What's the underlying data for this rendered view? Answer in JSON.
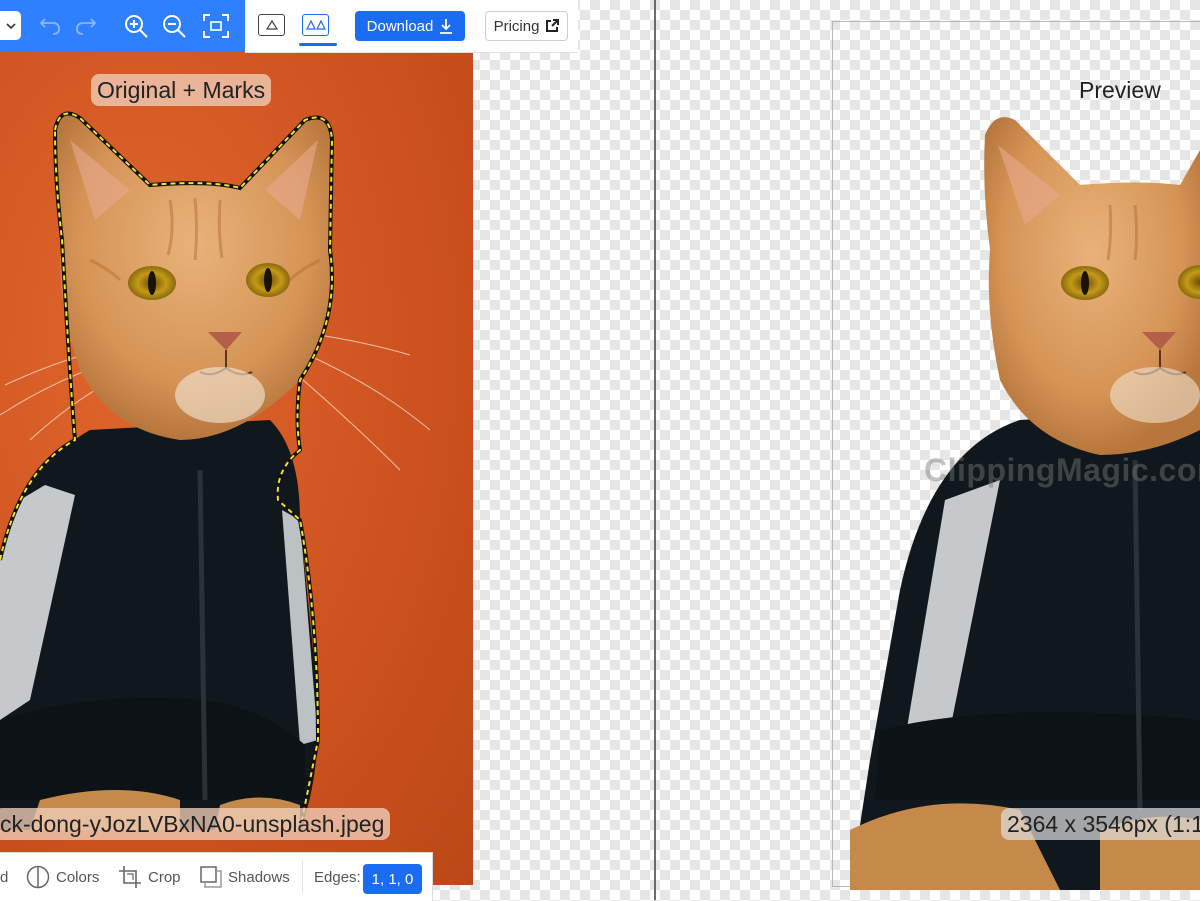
{
  "toolbar": {
    "download_label": "Download",
    "pricing_label": "Pricing"
  },
  "left_panel": {
    "title": "Original + Marks",
    "filename": "ck-dong-yJozLVBxNA0-unsplash.jpeg"
  },
  "right_panel": {
    "title": "Preview",
    "watermark": "ClippingMagic.com",
    "dimensions": "2364 x 3546px (1:1"
  },
  "bottom_toolbar": {
    "background_fragment": "d",
    "colors_label": "Colors",
    "crop_label": "Crop",
    "shadows_label": "Shadows",
    "edges_label": "Edges:",
    "edges_value": "1, 1, 0"
  },
  "colors": {
    "accent_blue": "#1a6cf2",
    "toolbar_blue": "#2f80ff",
    "background_orange": "#d45a22",
    "mask_outline": "#f2e02a"
  },
  "icons": [
    "chevron-down-icon",
    "undo-icon",
    "redo-icon",
    "zoom-in-icon",
    "zoom-out-icon",
    "fit-screen-icon",
    "download-icon",
    "external-link-icon",
    "colors-icon",
    "crop-icon",
    "shadows-icon"
  ]
}
